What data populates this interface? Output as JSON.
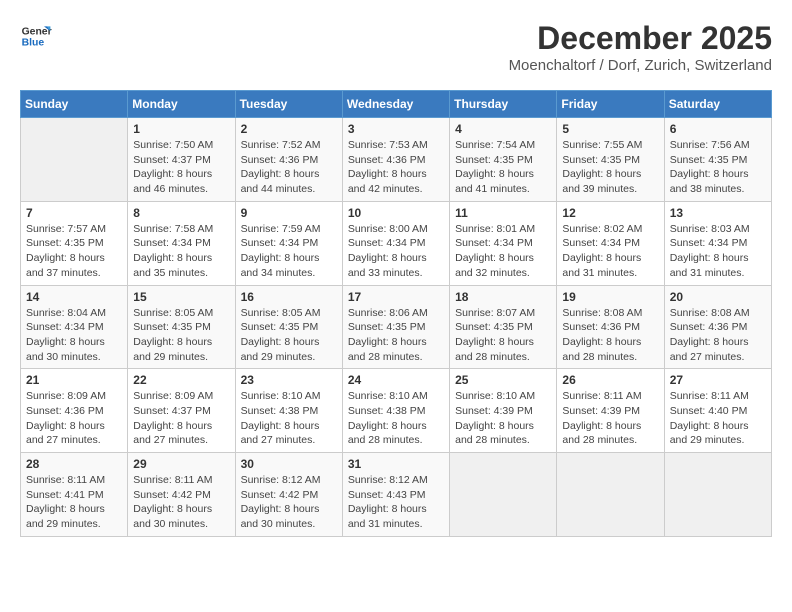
{
  "logo": {
    "line1": "General",
    "line2": "Blue"
  },
  "title": {
    "month_year": "December 2025",
    "location": "Moenchaltorf / Dorf, Zurich, Switzerland"
  },
  "weekdays": [
    "Sunday",
    "Monday",
    "Tuesday",
    "Wednesday",
    "Thursday",
    "Friday",
    "Saturday"
  ],
  "weeks": [
    [
      {
        "day": "",
        "info": ""
      },
      {
        "day": "1",
        "info": "Sunrise: 7:50 AM\nSunset: 4:37 PM\nDaylight: 8 hours\nand 46 minutes."
      },
      {
        "day": "2",
        "info": "Sunrise: 7:52 AM\nSunset: 4:36 PM\nDaylight: 8 hours\nand 44 minutes."
      },
      {
        "day": "3",
        "info": "Sunrise: 7:53 AM\nSunset: 4:36 PM\nDaylight: 8 hours\nand 42 minutes."
      },
      {
        "day": "4",
        "info": "Sunrise: 7:54 AM\nSunset: 4:35 PM\nDaylight: 8 hours\nand 41 minutes."
      },
      {
        "day": "5",
        "info": "Sunrise: 7:55 AM\nSunset: 4:35 PM\nDaylight: 8 hours\nand 39 minutes."
      },
      {
        "day": "6",
        "info": "Sunrise: 7:56 AM\nSunset: 4:35 PM\nDaylight: 8 hours\nand 38 minutes."
      }
    ],
    [
      {
        "day": "7",
        "info": "Sunrise: 7:57 AM\nSunset: 4:35 PM\nDaylight: 8 hours\nand 37 minutes."
      },
      {
        "day": "8",
        "info": "Sunrise: 7:58 AM\nSunset: 4:34 PM\nDaylight: 8 hours\nand 35 minutes."
      },
      {
        "day": "9",
        "info": "Sunrise: 7:59 AM\nSunset: 4:34 PM\nDaylight: 8 hours\nand 34 minutes."
      },
      {
        "day": "10",
        "info": "Sunrise: 8:00 AM\nSunset: 4:34 PM\nDaylight: 8 hours\nand 33 minutes."
      },
      {
        "day": "11",
        "info": "Sunrise: 8:01 AM\nSunset: 4:34 PM\nDaylight: 8 hours\nand 32 minutes."
      },
      {
        "day": "12",
        "info": "Sunrise: 8:02 AM\nSunset: 4:34 PM\nDaylight: 8 hours\nand 31 minutes."
      },
      {
        "day": "13",
        "info": "Sunrise: 8:03 AM\nSunset: 4:34 PM\nDaylight: 8 hours\nand 31 minutes."
      }
    ],
    [
      {
        "day": "14",
        "info": "Sunrise: 8:04 AM\nSunset: 4:34 PM\nDaylight: 8 hours\nand 30 minutes."
      },
      {
        "day": "15",
        "info": "Sunrise: 8:05 AM\nSunset: 4:35 PM\nDaylight: 8 hours\nand 29 minutes."
      },
      {
        "day": "16",
        "info": "Sunrise: 8:05 AM\nSunset: 4:35 PM\nDaylight: 8 hours\nand 29 minutes."
      },
      {
        "day": "17",
        "info": "Sunrise: 8:06 AM\nSunset: 4:35 PM\nDaylight: 8 hours\nand 28 minutes."
      },
      {
        "day": "18",
        "info": "Sunrise: 8:07 AM\nSunset: 4:35 PM\nDaylight: 8 hours\nand 28 minutes."
      },
      {
        "day": "19",
        "info": "Sunrise: 8:08 AM\nSunset: 4:36 PM\nDaylight: 8 hours\nand 28 minutes."
      },
      {
        "day": "20",
        "info": "Sunrise: 8:08 AM\nSunset: 4:36 PM\nDaylight: 8 hours\nand 27 minutes."
      }
    ],
    [
      {
        "day": "21",
        "info": "Sunrise: 8:09 AM\nSunset: 4:36 PM\nDaylight: 8 hours\nand 27 minutes."
      },
      {
        "day": "22",
        "info": "Sunrise: 8:09 AM\nSunset: 4:37 PM\nDaylight: 8 hours\nand 27 minutes."
      },
      {
        "day": "23",
        "info": "Sunrise: 8:10 AM\nSunset: 4:38 PM\nDaylight: 8 hours\nand 27 minutes."
      },
      {
        "day": "24",
        "info": "Sunrise: 8:10 AM\nSunset: 4:38 PM\nDaylight: 8 hours\nand 28 minutes."
      },
      {
        "day": "25",
        "info": "Sunrise: 8:10 AM\nSunset: 4:39 PM\nDaylight: 8 hours\nand 28 minutes."
      },
      {
        "day": "26",
        "info": "Sunrise: 8:11 AM\nSunset: 4:39 PM\nDaylight: 8 hours\nand 28 minutes."
      },
      {
        "day": "27",
        "info": "Sunrise: 8:11 AM\nSunset: 4:40 PM\nDaylight: 8 hours\nand 29 minutes."
      }
    ],
    [
      {
        "day": "28",
        "info": "Sunrise: 8:11 AM\nSunset: 4:41 PM\nDaylight: 8 hours\nand 29 minutes."
      },
      {
        "day": "29",
        "info": "Sunrise: 8:11 AM\nSunset: 4:42 PM\nDaylight: 8 hours\nand 30 minutes."
      },
      {
        "day": "30",
        "info": "Sunrise: 8:12 AM\nSunset: 4:42 PM\nDaylight: 8 hours\nand 30 minutes."
      },
      {
        "day": "31",
        "info": "Sunrise: 8:12 AM\nSunset: 4:43 PM\nDaylight: 8 hours\nand 31 minutes."
      },
      {
        "day": "",
        "info": ""
      },
      {
        "day": "",
        "info": ""
      },
      {
        "day": "",
        "info": ""
      }
    ]
  ]
}
